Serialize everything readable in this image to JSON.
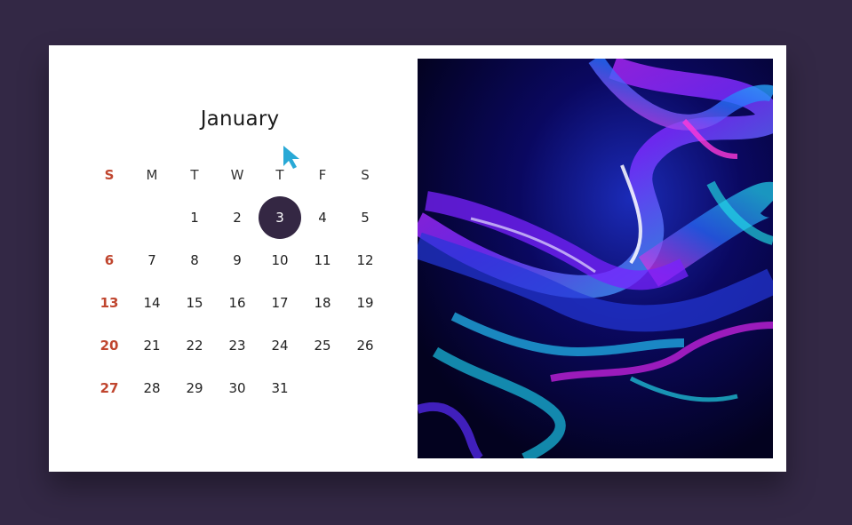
{
  "calendar": {
    "month": "January",
    "weekdays": [
      "S",
      "M",
      "T",
      "W",
      "T",
      "F",
      "S"
    ],
    "days": [
      "",
      "",
      "1",
      "2",
      "3",
      "4",
      "5",
      "6",
      "7",
      "8",
      "9",
      "10",
      "11",
      "12",
      "13",
      "14",
      "15",
      "16",
      "17",
      "18",
      "19",
      "20",
      "21",
      "22",
      "23",
      "24",
      "25",
      "26",
      "27",
      "28",
      "29",
      "30",
      "31",
      "",
      ""
    ],
    "today": "3"
  },
  "colors": {
    "background": "#332845",
    "sunday": "#c0462f",
    "today_highlight": "#342743",
    "cursor": "#29a9d6"
  },
  "image": {
    "icon": "abstract-fluid-art"
  }
}
